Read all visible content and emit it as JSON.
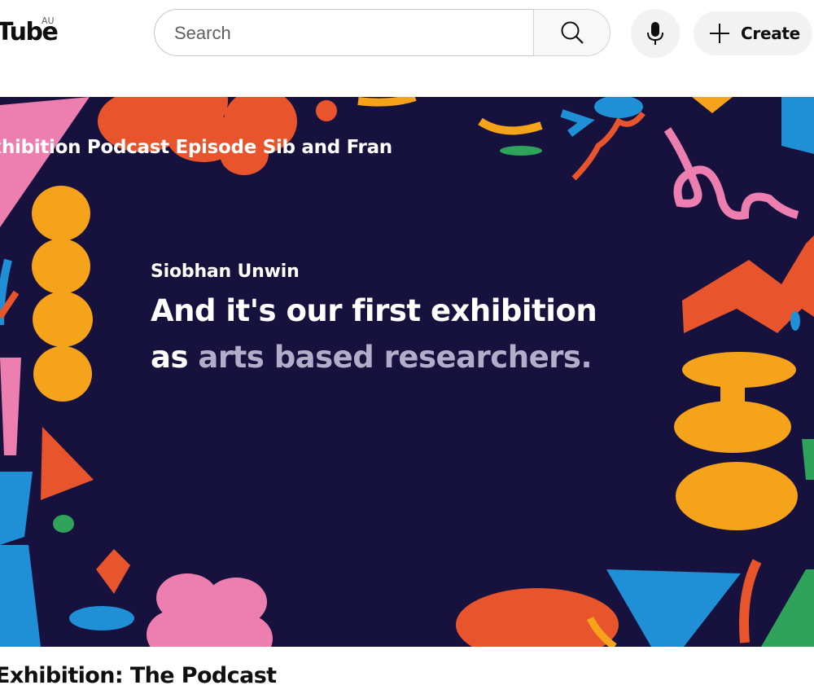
{
  "header": {
    "logo_text": "Tube",
    "region": "AU",
    "search": {
      "placeholder": "Search",
      "value": ""
    },
    "create_label": "Create"
  },
  "video": {
    "overlay_title": "Exhibition Podcast Episode Sib and Fran",
    "speaker": "Siobhan Unwin",
    "caption_line1": "And it's our first exhibition",
    "caption_line2_word1": "as",
    "caption_line2_word2": "arts based researchers.",
    "title": "Exhibition: The Podcast"
  },
  "colors": {
    "video_bg": "#17123d",
    "orange": "#e8542b",
    "yellow": "#f5a31a",
    "pink": "#ec7fb0",
    "blue": "#1f8fd6",
    "green": "#2fa35a",
    "muted_caption": "#b4adc9"
  },
  "icons": [
    "search-icon",
    "microphone-icon",
    "plus-icon"
  ]
}
